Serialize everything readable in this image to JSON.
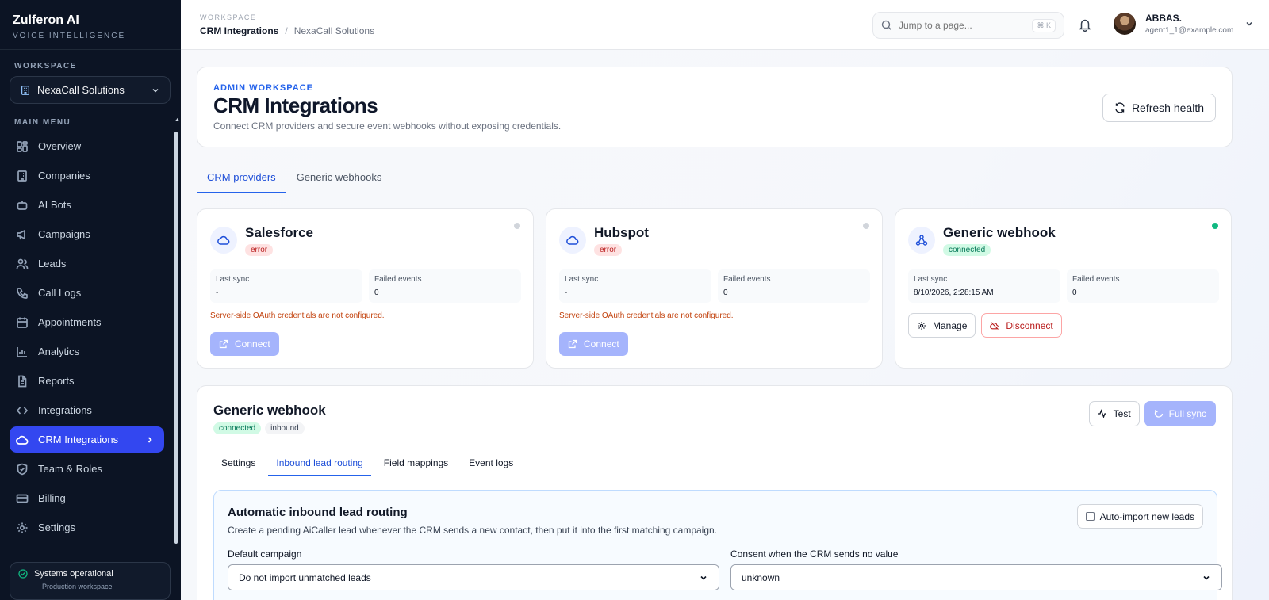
{
  "brand": {
    "name": "Zulferon AI",
    "tagline": "VOICE INTELLIGENCE"
  },
  "sidebar": {
    "workspace_label": "WORKSPACE",
    "workspace_value": "NexaCall Solutions",
    "menu_label": "MAIN MENU",
    "items": [
      {
        "label": "Overview",
        "icon": "grid-icon"
      },
      {
        "label": "Companies",
        "icon": "building-icon"
      },
      {
        "label": "AI Bots",
        "icon": "bot-icon"
      },
      {
        "label": "Campaigns",
        "icon": "megaphone-icon"
      },
      {
        "label": "Leads",
        "icon": "users-icon"
      },
      {
        "label": "Call Logs",
        "icon": "phone-icon"
      },
      {
        "label": "Appointments",
        "icon": "calendar-icon"
      },
      {
        "label": "Analytics",
        "icon": "bar-chart-icon"
      },
      {
        "label": "Reports",
        "icon": "document-icon"
      },
      {
        "label": "Integrations",
        "icon": "code-icon"
      },
      {
        "label": "CRM Integrations",
        "icon": "cloud-icon",
        "active": true
      },
      {
        "label": "Team & Roles",
        "icon": "shield-icon"
      },
      {
        "label": "Billing",
        "icon": "credit-card-icon"
      },
      {
        "label": "Settings",
        "icon": "gear-icon"
      }
    ],
    "status": {
      "title": "Systems operational",
      "subtitle": "Production workspace"
    }
  },
  "topbar": {
    "section_label": "WORKSPACE",
    "breadcrumb_current": "CRM Integrations",
    "breadcrumb_separator": "/",
    "breadcrumb_workspace": "NexaCall Solutions",
    "search_placeholder": "Jump to a page...",
    "search_shortcut": "⌘ K",
    "user_name": "ABBAS.",
    "user_email": "agent1_1@example.com"
  },
  "hero": {
    "eyebrow": "ADMIN WORKSPACE",
    "title": "CRM Integrations",
    "description": "Connect CRM providers and secure event webhooks without exposing credentials.",
    "refresh_label": "Refresh health"
  },
  "tabs": [
    {
      "label": "CRM providers",
      "active": true
    },
    {
      "label": "Generic webhooks",
      "active": false
    }
  ],
  "providers": [
    {
      "name": "Salesforce",
      "status": "error",
      "last_sync_label": "Last sync",
      "last_sync": "-",
      "failed_label": "Failed events",
      "failed": "0",
      "warning": "Server-side OAuth credentials are not configured.",
      "connect_label": "Connect"
    },
    {
      "name": "Hubspot",
      "status": "error",
      "last_sync_label": "Last sync",
      "last_sync": "-",
      "failed_label": "Failed events",
      "failed": "0",
      "warning": "Server-side OAuth credentials are not configured.",
      "connect_label": "Connect"
    },
    {
      "name": "Generic webhook",
      "status": "connected",
      "last_sync_label": "Last sync",
      "last_sync": "8/10/2026, 2:28:15 AM",
      "failed_label": "Failed events",
      "failed": "0",
      "manage_label": "Manage",
      "disconnect_label": "Disconnect"
    }
  ],
  "detail": {
    "title": "Generic webhook",
    "badges": [
      "connected",
      "inbound"
    ],
    "test_label": "Test",
    "full_sync_label": "Full sync",
    "subtabs": [
      {
        "label": "Settings",
        "active": false
      },
      {
        "label": "Inbound lead routing",
        "active": true
      },
      {
        "label": "Field mappings",
        "active": false
      },
      {
        "label": "Event logs",
        "active": false
      }
    ],
    "routing": {
      "title": "Automatic inbound lead routing",
      "description": "Create a pending AiCaller lead whenever the CRM sends a new contact, then put it into the first matching campaign.",
      "auto_import_label": "Auto-import new leads",
      "auto_import_checked": false,
      "default_campaign_label": "Default campaign",
      "default_campaign_value": "Do not import unmatched leads",
      "consent_label": "Consent when the CRM sends no value",
      "consent_value": "unknown"
    }
  },
  "colors": {
    "accent": "#3347f0",
    "sidebar_bg": "#0c1424",
    "error": "#b91c1c",
    "success": "#10b981"
  }
}
